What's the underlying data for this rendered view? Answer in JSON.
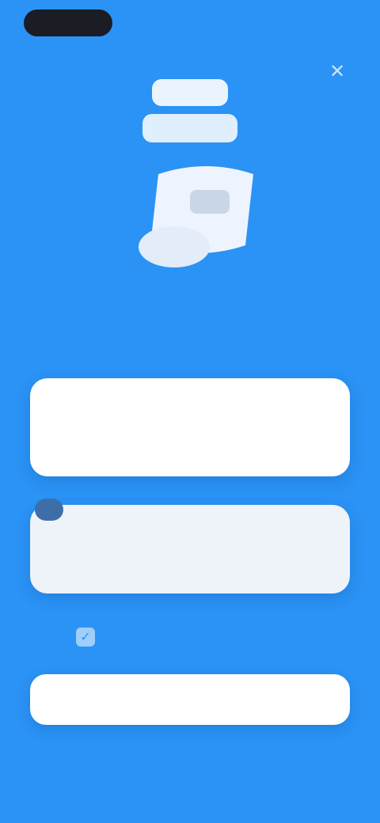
{
  "app": {
    "close_icon": "close-icon",
    "brand_color": "#2a93f5"
  },
  "hero": {
    "logo_icon": "brand-logo-icon",
    "illustration_icon": "hero-illustration-icon",
    "headline": ""
  },
  "plans": {
    "annual": {
      "name": "",
      "sub": "",
      "price": ""
    },
    "monthly": {
      "badge": "",
      "name": "",
      "sub": "",
      "price": ""
    }
  },
  "options": {
    "restore_label": "",
    "check_icon": "checkmark-icon"
  },
  "cta": {
    "label": ""
  }
}
